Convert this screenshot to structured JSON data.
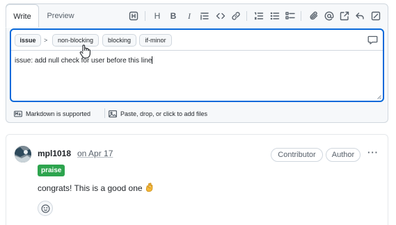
{
  "editor": {
    "tabs": [
      {
        "label": "Write",
        "active": true
      },
      {
        "label": "Preview",
        "active": false
      }
    ],
    "toolbar_icons": [
      "heading-block-icon",
      "heading-icon",
      "bold-icon",
      "italic-icon",
      "quote-icon",
      "code-icon",
      "link-icon",
      "numbered-list-icon",
      "bulleted-list-icon",
      "task-list-icon",
      "attach-icon",
      "mention-icon",
      "cross-reference-icon",
      "reply-icon",
      "fullscreen-icon"
    ],
    "toolbar_letters": {
      "heading": "H",
      "bold": "B",
      "italic": "I"
    },
    "labels": {
      "selected": "issue",
      "separator": ">",
      "options": [
        "non-blocking",
        "blocking",
        "if-minor"
      ]
    },
    "text": "issue: add null check for user before this line",
    "footer": {
      "markdown": "Markdown is supported",
      "attach": "Paste, drop, or click to add files"
    },
    "accent_color": "#0969da"
  },
  "comment": {
    "author": "mpl1018",
    "date": "on Apr 17",
    "badges": [
      "Contributor",
      "Author"
    ],
    "more": "···",
    "label": "praise",
    "label_color": "#2da44e",
    "body": "congrats! This is a good one",
    "emoji": "ok-hand-icon"
  }
}
